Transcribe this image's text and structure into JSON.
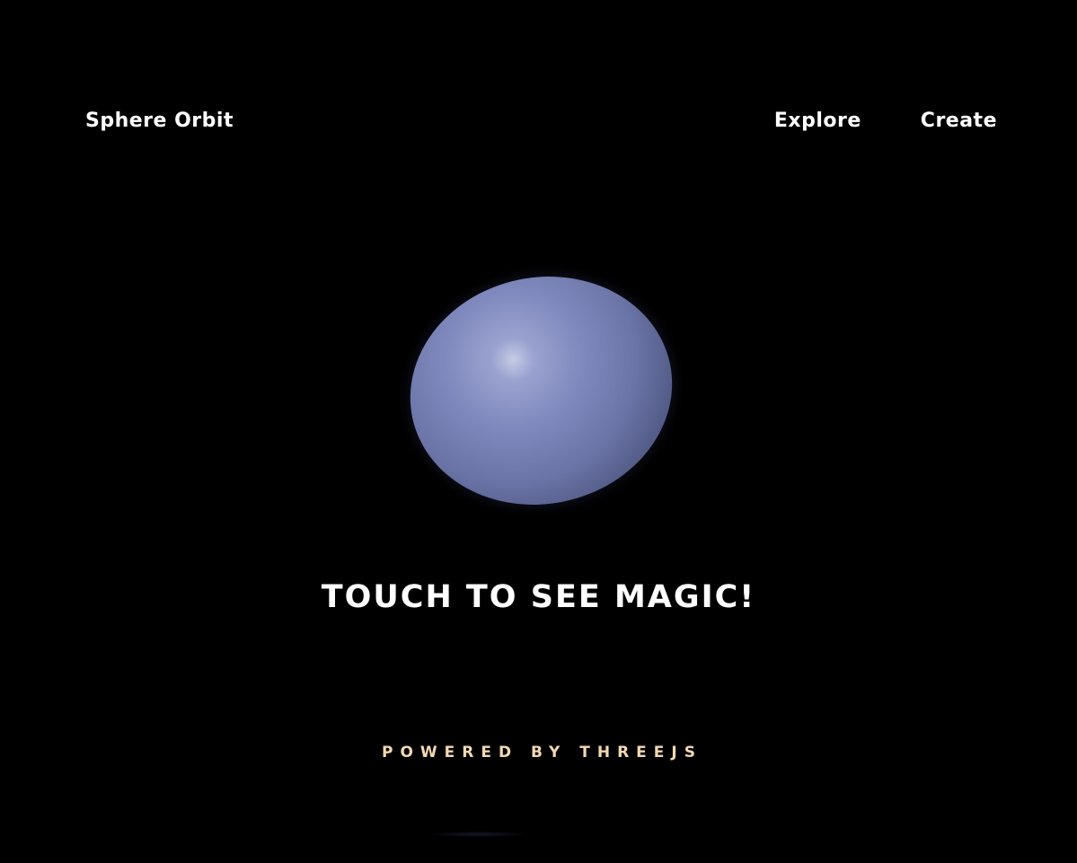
{
  "header": {
    "brand": "Sphere Orbit",
    "nav": [
      {
        "label": "Explore"
      },
      {
        "label": "Create"
      }
    ]
  },
  "main": {
    "cta_text": "TOUCH TO SEE MAGIC!"
  },
  "footer": {
    "text": "POWERED BY THREEJS"
  },
  "colors": {
    "background": "#000000",
    "text": "#ffffff",
    "footer_text": "#f3d9b1",
    "sphere": "#7f89bd"
  }
}
